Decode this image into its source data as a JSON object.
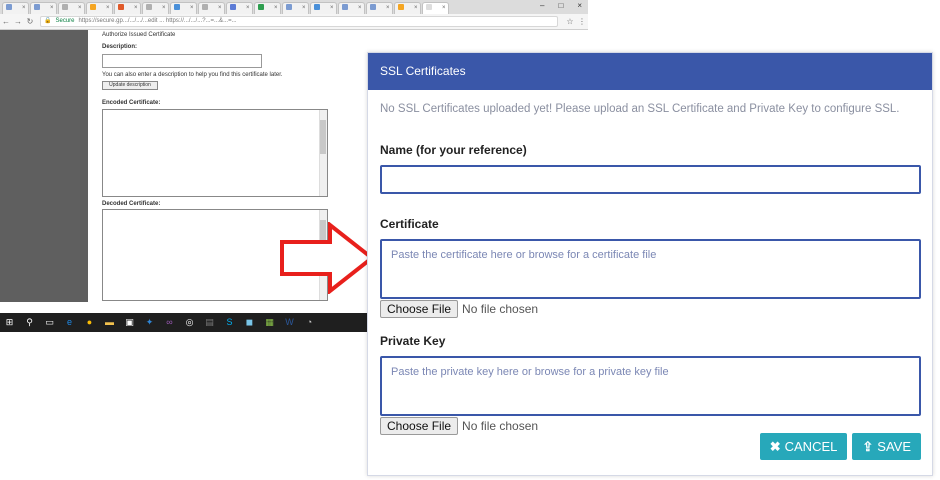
{
  "browser": {
    "tabs": [
      {
        "fav_color": "#7b9bd1"
      },
      {
        "fav_color": "#7b9bd1"
      },
      {
        "fav_color": "#b0b0b0"
      },
      {
        "fav_color": "#f5a623"
      },
      {
        "fav_color": "#e05a2a"
      },
      {
        "fav_color": "#b0b0b0"
      },
      {
        "fav_color": "#4a90d9"
      },
      {
        "fav_color": "#b0b0b0"
      },
      {
        "fav_color": "#5c7bd6"
      },
      {
        "fav_color": "#2e9e4f"
      },
      {
        "fav_color": "#7b9bd1"
      },
      {
        "fav_color": "#4a90d9"
      },
      {
        "fav_color": "#7b9bd1"
      },
      {
        "fav_color": "#7b9bd1"
      },
      {
        "fav_color": "#f5a623"
      },
      {
        "fav_color": "#dddddd"
      }
    ],
    "window_controls": [
      "–",
      "□",
      "×"
    ],
    "nav_icons": [
      "back-icon",
      "forward-icon",
      "reload-icon"
    ],
    "secure_label": "Secure",
    "url": "https://secure.gp.../.../.../...edit ...  https://.../.../...?...=...&...=...",
    "bg_page": {
      "heading": "Authorize Issued Certificate",
      "description_label": "Description:",
      "description_help": "You can also enter a description to help you find this certificate later.",
      "update_button": "Update description",
      "encoded_label": "Encoded Certificate:",
      "decoded_label": "Decoded Certificate:"
    },
    "taskbar_icons": [
      {
        "name": "windows-start-icon",
        "glyph": "⊞",
        "color": "#ffffff"
      },
      {
        "name": "search-icon",
        "glyph": "⚲",
        "color": "#ffffff"
      },
      {
        "name": "task-view-icon",
        "glyph": "▭",
        "color": "#ffffff"
      },
      {
        "name": "edge-icon",
        "glyph": "e",
        "color": "#1e88e5"
      },
      {
        "name": "chrome-icon",
        "glyph": "●",
        "color": "#fbbc05"
      },
      {
        "name": "file-explorer-icon",
        "glyph": "▬",
        "color": "#f2c14e"
      },
      {
        "name": "store-icon",
        "glyph": "▣",
        "color": "#ffffff"
      },
      {
        "name": "dropbox-icon",
        "glyph": "✦",
        "color": "#2f86d6"
      },
      {
        "name": "infinity-icon",
        "glyph": "∞",
        "color": "#9b59b6"
      },
      {
        "name": "steam-icon",
        "glyph": "◎",
        "color": "#ffffff"
      },
      {
        "name": "app-icon",
        "glyph": "▤",
        "color": "#7a7a7a"
      },
      {
        "name": "skype-icon",
        "glyph": "S",
        "color": "#00aff0"
      },
      {
        "name": "app-icon",
        "glyph": "◼",
        "color": "#79c5e8"
      },
      {
        "name": "green-app-icon",
        "glyph": "▦",
        "color": "#8bc34a"
      },
      {
        "name": "word-icon",
        "glyph": "W",
        "color": "#2b579a"
      },
      {
        "name": "app-icon",
        "glyph": "◔",
        "color": "#cccccc"
      }
    ]
  },
  "modal": {
    "title": "SSL Certificates",
    "notice": "No SSL Certificates uploaded yet! Please upload an SSL Certificate and Private Key to configure SSL.",
    "name_label": "Name (for your reference)",
    "name_value": "",
    "certificate_label": "Certificate",
    "certificate_placeholder": "Paste the certificate here or browse for a certificate file",
    "private_key_label": "Private Key",
    "private_key_placeholder": "Paste the private key here or browse for a private key file",
    "choose_file_label": "Choose File",
    "no_file_text": "No file chosen",
    "cancel_label": "CANCEL",
    "save_label": "SAVE",
    "accent_color": "#3a57a9",
    "button_color": "#27a8ba"
  },
  "annotation": {
    "arrow_color": "#e8201c"
  }
}
